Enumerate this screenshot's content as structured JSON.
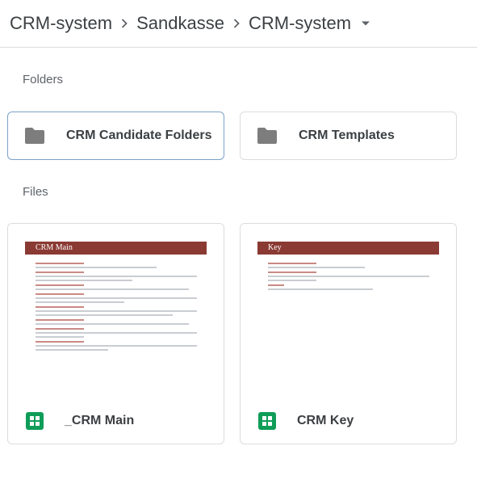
{
  "breadcrumb": {
    "items": [
      {
        "label": "CRM-system"
      },
      {
        "label": "Sandkasse"
      },
      {
        "label": "CRM-system"
      }
    ]
  },
  "sections": {
    "folders_label": "Folders",
    "files_label": "Files"
  },
  "folders": [
    {
      "name": "CRM Candidate Folders",
      "icon": "folder-icon",
      "selected": true
    },
    {
      "name": "CRM Templates",
      "icon": "folder-icon",
      "selected": false
    }
  ],
  "files": [
    {
      "name": "_CRM Main",
      "icon": "google-sheets-icon",
      "thumbnail_title": "CRM Main"
    },
    {
      "name": "CRM Key",
      "icon": "google-sheets-icon",
      "thumbnail_title": "Key"
    }
  ],
  "colors": {
    "sheets_green": "#0f9d58",
    "thumbnail_banner": "#8a3a33",
    "folder_gray": "#7d7d7d",
    "selected_border": "#7ba2c9"
  }
}
